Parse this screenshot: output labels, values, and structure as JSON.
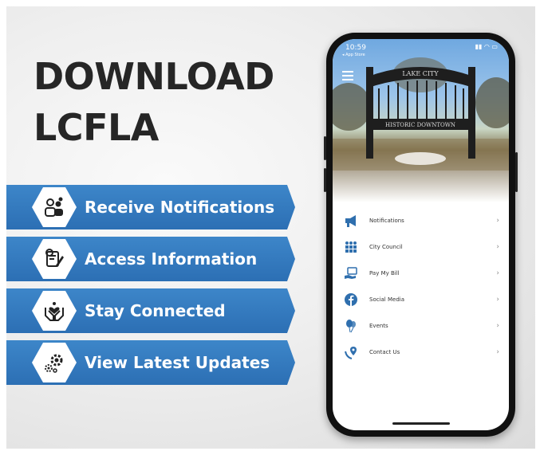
{
  "headline": [
    "DOWNLOAD",
    "LCFLA"
  ],
  "features": [
    {
      "label": "Receive Notifications",
      "icon": "people-notification-icon"
    },
    {
      "label": "Access Information",
      "icon": "document-info-icon"
    },
    {
      "label": "Stay Connected",
      "icon": "hands-heart-icon"
    },
    {
      "label": "View Latest Updates",
      "icon": "gears-icon"
    }
  ],
  "phone": {
    "status_time": "10:59",
    "status_sub": "◂ App Store",
    "status_right": "▮▮ ◠ ▭",
    "hero": {
      "sign_top": "LAKE CITY",
      "sign_bottom": "HISTORIC DOWNTOWN"
    },
    "menu": [
      {
        "label": "Notifications",
        "icon": "megaphone-icon"
      },
      {
        "label": "City Council",
        "icon": "people-group-icon"
      },
      {
        "label": "Pay My Bill",
        "icon": "bill-payment-icon"
      },
      {
        "label": "Social Media",
        "icon": "facebook-icon"
      },
      {
        "label": "Events",
        "icon": "balloons-icon"
      },
      {
        "label": "Contact Us",
        "icon": "contact-pin-icon"
      }
    ],
    "chevron": "›"
  },
  "colors": {
    "banner": "#2f74b8",
    "menu_icon": "#2f6fae",
    "headline": "#262626"
  }
}
